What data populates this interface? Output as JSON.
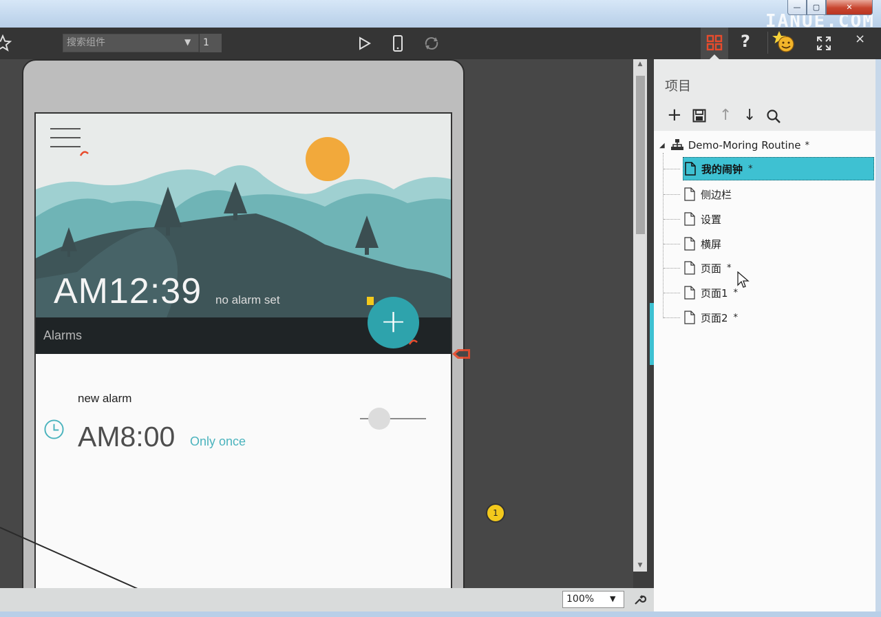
{
  "window": {
    "watermark": "IANUE.COM",
    "minimize_label": "—",
    "maximize_label": "▢",
    "close_label": "✕"
  },
  "toolbar": {
    "search_placeholder": "搜索组件",
    "page_number": "1",
    "help_label": "?",
    "close_label": "×",
    "icons": [
      "star-icon",
      "play-icon",
      "phone-icon",
      "rotate-icon",
      "grid-icon",
      "help-icon",
      "emoji-icon",
      "fullscreen-icon",
      "close-icon"
    ]
  },
  "phone_screen": {
    "time": "AM12:39",
    "alarm_status": "no alarm set",
    "section_title": "Alarms",
    "fab_label": "+",
    "alarm": {
      "name": "new alarm",
      "time": "AM8:00",
      "repeat": "Only once",
      "enabled": false
    },
    "colors": {
      "sun": "#f2a93b",
      "hill_light": "#8cc6c8",
      "hill_dark": "#3e5558",
      "bar": "#1f2426",
      "fab": "#2ea3ac"
    }
  },
  "canvas": {
    "note_badge": "1"
  },
  "statusbar": {
    "zoom": "100%"
  },
  "project_panel": {
    "title": "项目",
    "tools": [
      "add-icon",
      "save-icon",
      "move-up-icon",
      "move-down-icon",
      "search-icon"
    ],
    "add_label": "+",
    "up_label": "↑",
    "down_label": "↓",
    "root": {
      "label": "Demo-Moring Routine",
      "modified": "*"
    },
    "pages": [
      {
        "label": "我的闹钟",
        "modified": "*",
        "selected": true
      },
      {
        "label": "侧边栏",
        "modified": "",
        "selected": false
      },
      {
        "label": "设置",
        "modified": "",
        "selected": false
      },
      {
        "label": "横屏",
        "modified": "",
        "selected": false
      },
      {
        "label": "页面",
        "modified": "*",
        "selected": false
      },
      {
        "label": "页面1",
        "modified": "*",
        "selected": false
      },
      {
        "label": "页面2",
        "modified": "*",
        "selected": false
      }
    ],
    "accent": "#3ec1d2"
  }
}
